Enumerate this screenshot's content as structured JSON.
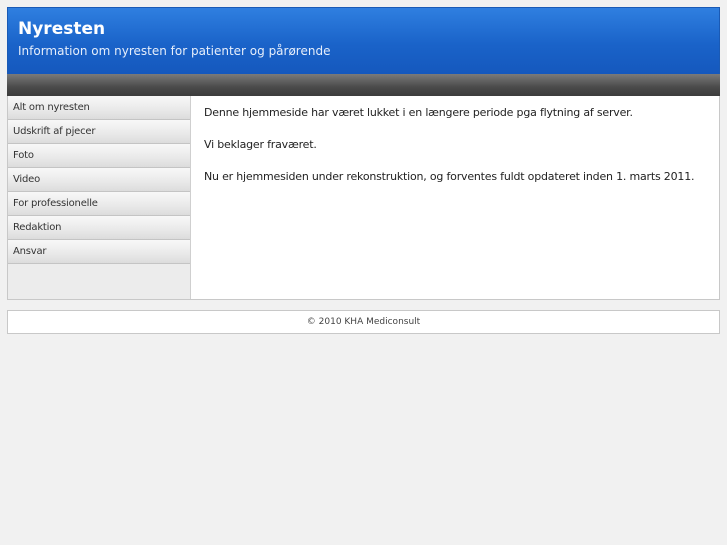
{
  "header": {
    "title": "Nyresten",
    "subtitle": "Information om nyresten for patienter og pårørende"
  },
  "sidebar": {
    "items": [
      {
        "label": "Alt om nyresten"
      },
      {
        "label": "Udskrift af pjecer"
      },
      {
        "label": "Foto"
      },
      {
        "label": "Video"
      },
      {
        "label": "For professionelle"
      },
      {
        "label": "Redaktion"
      },
      {
        "label": "Ansvar"
      }
    ]
  },
  "main": {
    "paragraphs": [
      "Denne hjemmeside har været lukket i en længere periode pga flytning af server.",
      "Vi beklager fraværet.",
      "Nu er hjemmesiden under rekonstruktion, og forventes fuldt opdateret inden 1. marts 2011."
    ]
  },
  "footer": {
    "copyright": "© 2010 KHA Mediconsult"
  },
  "colors": {
    "header_blue": "#1a63c9",
    "dark_bar": "#4a4a4a",
    "sidebar_bg": "#ececec",
    "page_bg": "#f1f1f1"
  }
}
